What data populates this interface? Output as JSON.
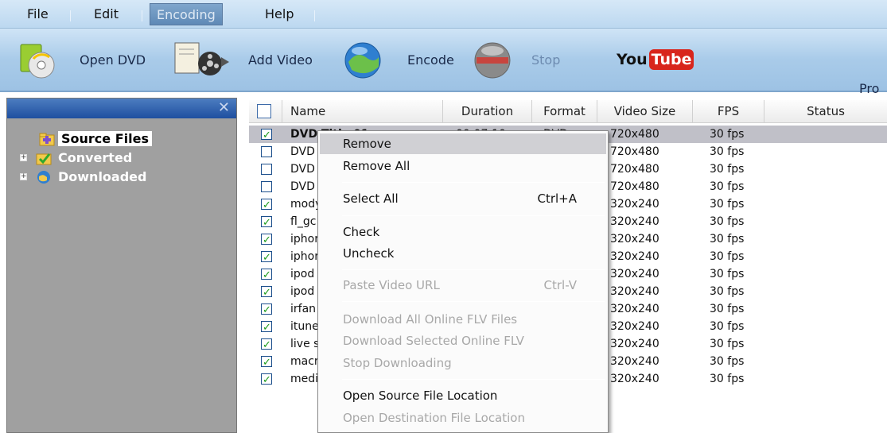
{
  "menu": {
    "items": [
      {
        "label": "File"
      },
      {
        "label": "Edit"
      },
      {
        "label": "Encoding"
      },
      {
        "label": "Help"
      }
    ]
  },
  "toolbar": {
    "open_dvd": "Open DVD",
    "add_video": "Add Video",
    "encode": "Encode",
    "stop": "Stop",
    "youtube_you": "You",
    "youtube_tube": "Tube",
    "pro": "Pro"
  },
  "left_panel": {
    "close": "✕",
    "tree": [
      {
        "label": "Source Files"
      },
      {
        "label": "Converted"
      },
      {
        "label": "Downloaded"
      }
    ]
  },
  "list": {
    "columns": [
      "Name",
      "Duration",
      "Format",
      "Video Size",
      "FPS",
      "Status"
    ],
    "rows": [
      {
        "name": "DVD Title 01",
        "duration": "00:07:10",
        "format": "DVD",
        "size": "720x480",
        "fps": "30 fps",
        "checked": true
      },
      {
        "name": "DVD",
        "size": "720x480",
        "fps": "30 fps",
        "checked": false
      },
      {
        "name": "DVD",
        "size": "720x480",
        "fps": "30 fps",
        "checked": false
      },
      {
        "name": "DVD",
        "size": "720x480",
        "fps": "30 fps",
        "checked": false
      },
      {
        "name": "mody",
        "size": "320x240",
        "fps": "30 fps",
        "checked": true
      },
      {
        "name": "fl_gc",
        "size": "320x240",
        "fps": "30 fps",
        "checked": true
      },
      {
        "name": "iphor",
        "size": "320x240",
        "fps": "30 fps",
        "checked": true
      },
      {
        "name": "iphor",
        "size": "320x240",
        "fps": "30 fps",
        "checked": true
      },
      {
        "name": "ipod",
        "size": "320x240",
        "fps": "30 fps",
        "checked": true
      },
      {
        "name": "ipod",
        "size": "320x240",
        "fps": "30 fps",
        "checked": true
      },
      {
        "name": "irfan",
        "size": "320x240",
        "fps": "30 fps",
        "checked": true
      },
      {
        "name": "itune",
        "size": "320x240",
        "fps": "30 fps",
        "checked": true
      },
      {
        "name": "live s",
        "size": "320x240",
        "fps": "30 fps",
        "checked": true
      },
      {
        "name": "macr",
        "size": "320x240",
        "fps": "30 fps",
        "checked": true
      },
      {
        "name": "medi",
        "size": "320x240",
        "fps": "30 fps",
        "checked": true
      }
    ]
  },
  "context_menu": {
    "remove": "Remove",
    "remove_all": "Remove All",
    "select_all": "Select All",
    "select_all_sc": "Ctrl+A",
    "check": "Check",
    "uncheck": "Uncheck",
    "paste_url": "Paste Video URL",
    "paste_url_sc": "Ctrl-V",
    "download_all": "Download All Online FLV Files",
    "download_selected": "Download Selected Online FLV",
    "stop_downloading": "Stop Downloading",
    "open_source": "Open Source File Location",
    "open_dest": "Open Destination File Location"
  },
  "colors": {
    "menubar": "#c8e0f4",
    "selection": "#c0c0c8",
    "panel": "#a0a0a0",
    "panel_header": "#2a5caa"
  }
}
